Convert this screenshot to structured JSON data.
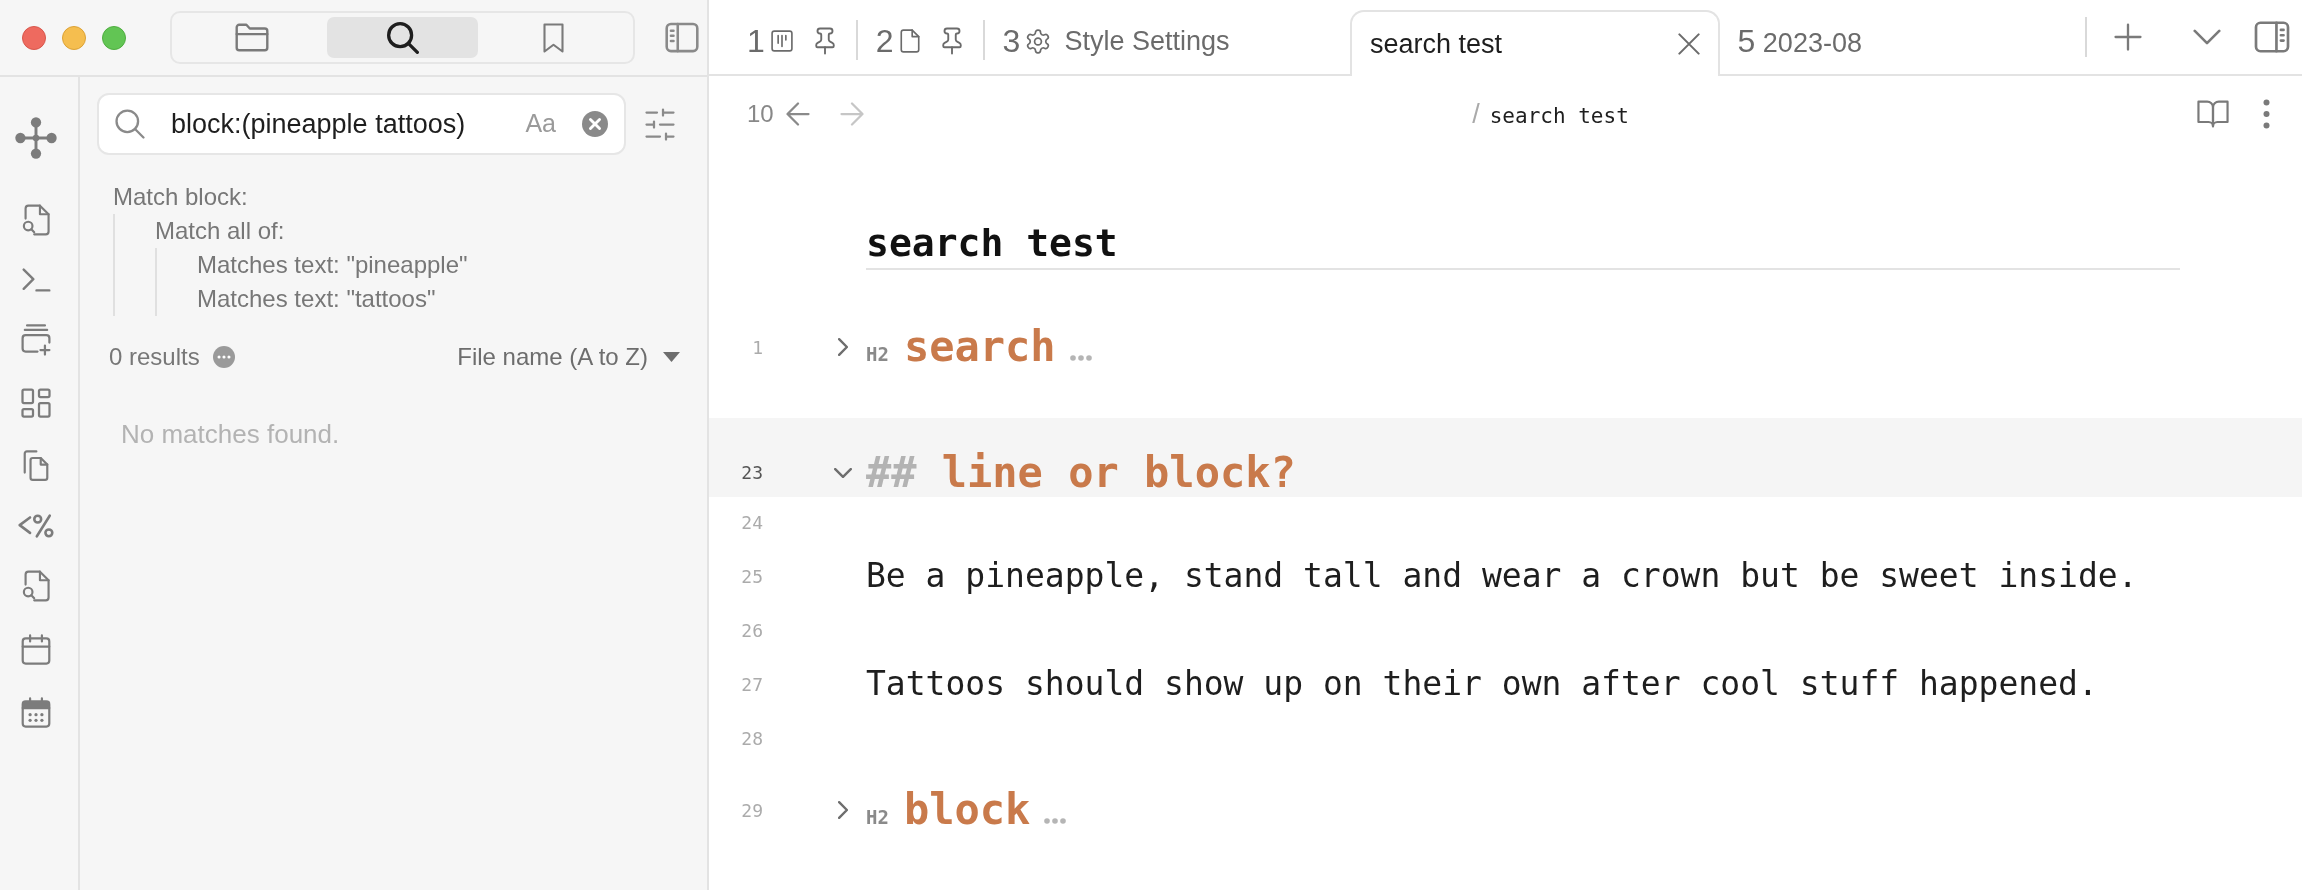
{
  "sidebar_tabs": [
    {
      "selected": false
    },
    {
      "selected": true
    },
    {
      "selected": false
    }
  ],
  "search": {
    "query": "block:(pineapple tattoos)",
    "match_case_label": "Aa"
  },
  "query_explanation": {
    "label": "Match block:",
    "children": [
      {
        "label": "Match all of:",
        "children": [
          {
            "label": "Matches text: \"pineapple\""
          },
          {
            "label": "Matches text: \"tattoos\""
          }
        ]
      }
    ]
  },
  "results": {
    "count": "0 results",
    "sort_label": "File name (A to Z)",
    "empty_message": "No matches found."
  },
  "tabs": [
    {
      "number": "1",
      "kind": "board",
      "pinned": true,
      "selected": false
    },
    {
      "number": "2",
      "kind": "file",
      "pinned": true,
      "selected": false
    },
    {
      "number": "3",
      "kind": "settings",
      "title": "Style Settings",
      "pinned": false,
      "selected": false
    },
    {
      "kind": "plain",
      "title": "search test",
      "pinned": false,
      "selected": true
    },
    {
      "number": "5",
      "kind": "plain",
      "title": "2023-08",
      "pinned": false,
      "selected": false
    }
  ],
  "navigation": {
    "history_count": "10",
    "back_disabled": false,
    "forward_disabled": true,
    "breadcrumb_separator": "/",
    "breadcrumb_title": "search test"
  },
  "document": {
    "title": "search test",
    "lines": [
      {
        "number": "1",
        "kind": "heading",
        "level_label": "H2",
        "text": "search",
        "folded": true,
        "active": false
      },
      {
        "number": "23",
        "kind": "heading_source",
        "marker": "##",
        "text": "line or block?",
        "folded": false,
        "active": true
      },
      {
        "number": "24",
        "kind": "blank",
        "active": false
      },
      {
        "number": "25",
        "kind": "paragraph",
        "text": "Be a pineapple, stand tall and wear a crown but be sweet inside.",
        "active": false
      },
      {
        "number": "26",
        "kind": "blank",
        "active": false
      },
      {
        "number": "27",
        "kind": "paragraph",
        "text": "Tattoos should show up on their own after cool stuff happened.",
        "active": false
      },
      {
        "number": "28",
        "kind": "blank",
        "active": false
      },
      {
        "number": "29",
        "kind": "heading",
        "level_label": "H2",
        "text": "block",
        "folded": true,
        "active": false
      }
    ]
  }
}
